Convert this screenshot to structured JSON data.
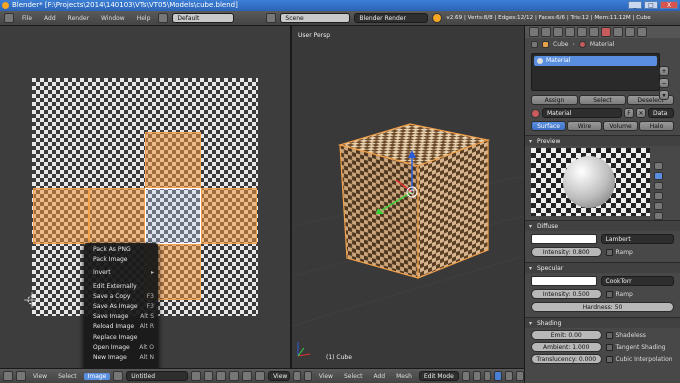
{
  "window": {
    "title": "Blender* [F:\\Projects\\2014\\140103\\VTs\\VT05\\Models\\cube.blend]",
    "min_label": "_",
    "max_label": "□",
    "close_label": "X"
  },
  "info_header": {
    "menus": [
      "File",
      "Add",
      "Render",
      "Window",
      "Help"
    ],
    "layout": "Default",
    "scene": "Scene",
    "engine": "Blender Render",
    "stats": "v2.69 | Verts:8/8 | Edges:12/12 | Faces:6/6 | Tris:12 | Mem:11.12M | Cube"
  },
  "context_menu": {
    "items": [
      {
        "label": "Pack As PNG",
        "shortcut": ""
      },
      {
        "label": "Pack Image",
        "shortcut": ""
      },
      {
        "label": "Invert",
        "shortcut": "▸"
      },
      {
        "label": "Edit Externally",
        "shortcut": ""
      },
      {
        "label": "Save a Copy",
        "shortcut": "F3"
      },
      {
        "label": "Save As Image",
        "shortcut": "F3"
      },
      {
        "label": "Save Image",
        "shortcut": "Alt S"
      },
      {
        "label": "Reload Image",
        "shortcut": "Alt R"
      },
      {
        "label": "Replace Image",
        "shortcut": ""
      },
      {
        "label": "Open Image",
        "shortcut": "Alt O"
      },
      {
        "label": "New Image",
        "shortcut": "Alt N"
      }
    ]
  },
  "uv_bottom": {
    "menus": [
      "View",
      "Select",
      "Image"
    ],
    "image_name": "Untitled",
    "view_label": "View"
  },
  "viewport": {
    "label": "User Persp",
    "object_label": "(1) Cube",
    "menus": [
      "View",
      "Select",
      "Add",
      "Mesh"
    ],
    "mode": "Edit Mode"
  },
  "properties": {
    "breadcrumb_object": "Cube",
    "breadcrumb_material": "Material",
    "material_slot": "Material",
    "assign": "Assign",
    "select": "Select",
    "deselect": "Deselect",
    "material_name": "Material",
    "data_label": "Data",
    "tabs": [
      "Surface",
      "Wire",
      "Volume",
      "Halo"
    ],
    "preview_header": "Preview",
    "diffuse_header": "Diffuse",
    "diffuse_shader": "Lambert",
    "diffuse_intensity": "Intensity: 0.800",
    "ramp_label": "Ramp",
    "specular_header": "Specular",
    "specular_shader": "CookTorr",
    "specular_intensity": "Intensity: 0.500",
    "hardness": "Hardness: 50",
    "shading_header": "Shading",
    "emit": "Emit: 0.00",
    "ambient": "Ambient: 1.000",
    "translucency": "Translucency: 0.000",
    "shadeless": "Shadeless",
    "tangent_shading": "Tangent Shading",
    "cubic_interpolation": "Cubic Interpolation"
  },
  "colors": {
    "selection_orange": "#f2a14a",
    "active_blue": "#4a7fd6"
  }
}
